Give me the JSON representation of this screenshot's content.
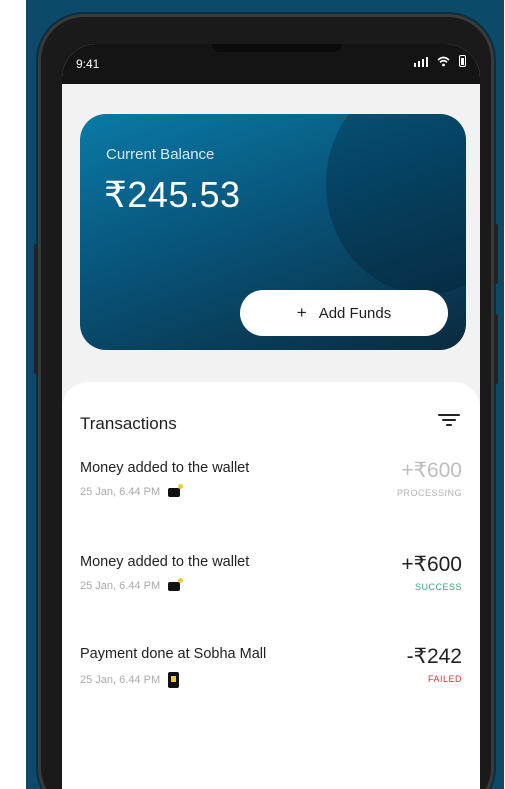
{
  "status_bar": {
    "time": "9:41"
  },
  "balance_card": {
    "label": "Current Balance",
    "amount": "₹245.53",
    "add_funds_icon": "+",
    "add_funds_label": "Add Funds"
  },
  "transactions": {
    "title": "Transactions",
    "filter_icon": "filter-icon",
    "items": [
      {
        "description": "Money added to the wallet",
        "datetime": "25 Jan, 6.44 PM",
        "icon": "wallet-icon",
        "amount": "+₹600",
        "status": "PROCESSING"
      },
      {
        "description": "Money added to the wallet",
        "datetime": "25 Jan, 6.44 PM",
        "icon": "wallet-icon",
        "amount": "+₹600",
        "status": "SUCCESS"
      },
      {
        "description": "Payment done at Sobha Mall",
        "datetime": "25 Jan, 6.44 PM",
        "icon": "mobile-payment-icon",
        "amount": "-₹242",
        "status": "FAILED"
      }
    ]
  },
  "colors": {
    "background": "#0c4a69",
    "card_gradient_start": "#0a7aa6",
    "card_gradient_end": "#0a2a3e",
    "success": "#3aa37c",
    "failed": "#c43a3a",
    "processing": "#b3b3b3"
  }
}
